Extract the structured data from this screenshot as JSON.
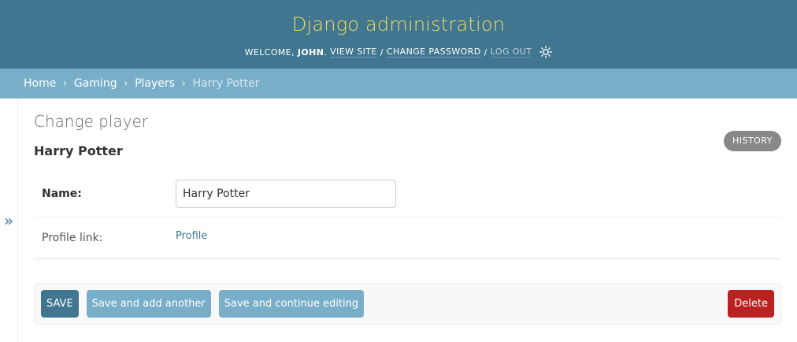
{
  "header": {
    "site_name": "Django administration",
    "welcome": "WELCOME,",
    "username": "JOHN",
    "view_site": "VIEW SITE",
    "change_password": "CHANGE PASSWORD",
    "log_out": "LOG OUT",
    "separator": "/",
    "theme_icon": "sun-icon"
  },
  "breadcrumbs": {
    "home": "Home",
    "app": "Gaming",
    "model": "Players",
    "current": "Harry Potter",
    "separator": "›"
  },
  "sidebar_toggle": "»",
  "content": {
    "page_title": "Change player",
    "history_label": "HISTORY",
    "object_title": "Harry Potter",
    "fields": {
      "name_label": "Name:",
      "name_value": "Harry Potter",
      "profile_label": "Profile link:",
      "profile_link_text": "Profile"
    }
  },
  "submit_row": {
    "save": "SAVE",
    "save_add_another": "Save and add another",
    "save_continue": "Save and continue editing",
    "delete": "Delete"
  },
  "colors": {
    "header_bg": "#417690",
    "site_name": "#f5dd5d",
    "breadcrumbs_bg": "#79aec8",
    "primary_button": "#417690",
    "secondary_button": "#79aec8",
    "delete_button": "#ba2121",
    "history_button": "#888888"
  }
}
